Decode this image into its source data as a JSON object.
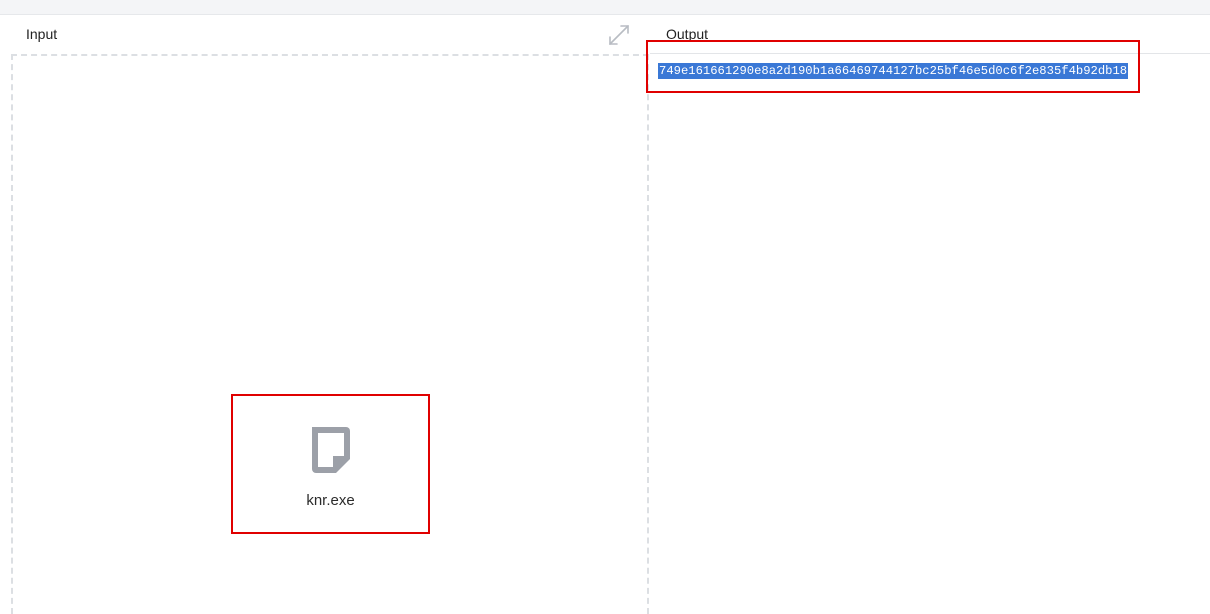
{
  "input_panel": {
    "title": "Input",
    "file": {
      "name": "knr.exe",
      "icon": "file-icon"
    },
    "maximize_icon": "maximize-icon"
  },
  "output_panel": {
    "title": "Output",
    "value": "749e161661290e8a2d190b1a66469744127bc25bf46e5d0c6f2e835f4b92db18"
  },
  "colors": {
    "highlight_border": "#e00000",
    "selection_background": "#3a78d6",
    "icon_gray": "#9ca0a8"
  }
}
